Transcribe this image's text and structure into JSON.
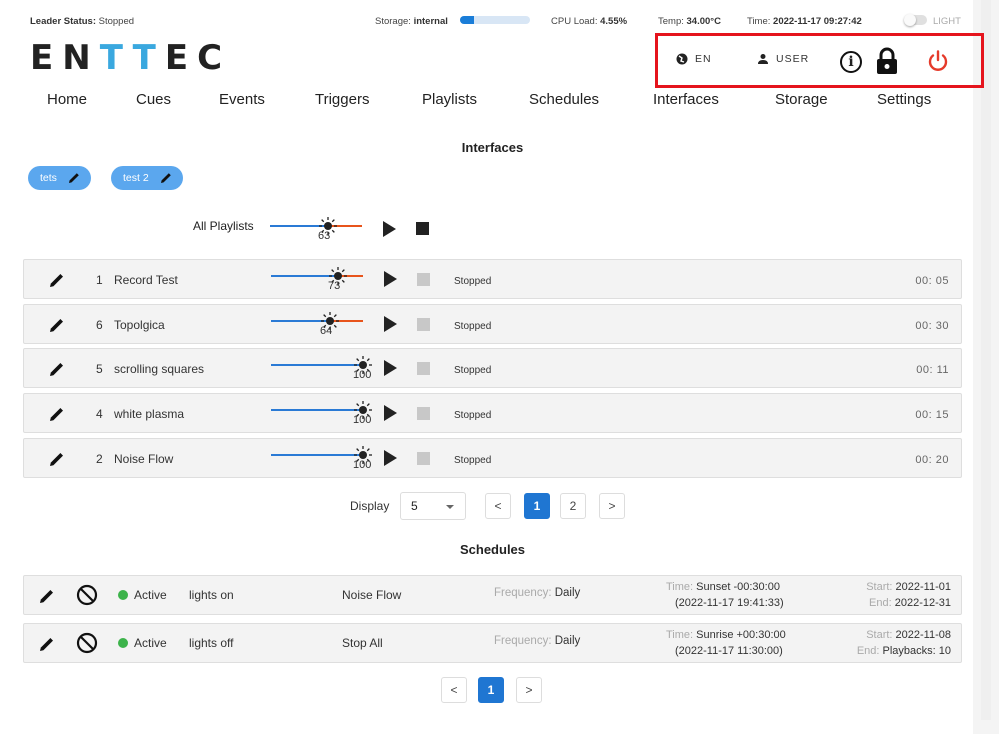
{
  "status": {
    "leader_label": "Leader Status:",
    "leader_value": "Stopped",
    "storage_label": "Storage:",
    "storage_value": "internal",
    "storage_fill": 0.2,
    "cpu_label": "CPU Load:",
    "cpu_value": "4.55%",
    "temp_label": "Temp:",
    "temp_value": "34.00°C",
    "time_label": "Time:",
    "time_value": "2022-11-17 09:27:42",
    "theme_label": "LIGHT"
  },
  "logo": {
    "part1": "EN",
    "part2": "TT",
    "part3": "EC"
  },
  "header": {
    "language": "EN",
    "user": "USER"
  },
  "nav": [
    "Home",
    "Cues",
    "Events",
    "Triggers",
    "Playlists",
    "Schedules",
    "Interfaces",
    "Storage",
    "Settings"
  ],
  "interfaces": {
    "title": "Interfaces",
    "chips": [
      "tets",
      "test 2"
    ],
    "all_label": "All Playlists",
    "all_value": 63
  },
  "playlists": [
    {
      "num": "1",
      "name": "Record Test",
      "level": 73,
      "status": "Stopped",
      "time": "00: 05"
    },
    {
      "num": "6",
      "name": "Topolgica",
      "level": 64,
      "status": "Stopped",
      "time": "00: 30"
    },
    {
      "num": "5",
      "name": "scrolling squares",
      "level": 100,
      "status": "Stopped",
      "time": "00: 11"
    },
    {
      "num": "4",
      "name": "white plasma",
      "level": 100,
      "status": "Stopped",
      "time": "00: 15"
    },
    {
      "num": "2",
      "name": "Noise Flow",
      "level": 100,
      "status": "Stopped",
      "time": "00: 20"
    }
  ],
  "pagination": {
    "display_label": "Display",
    "display_value": "5",
    "pages": [
      "1",
      "2"
    ],
    "current": "1",
    "prev": "<",
    "next": ">"
  },
  "schedules": {
    "title": "Schedules",
    "rows": [
      {
        "state": "Active",
        "name": "lights on",
        "playlist": "Noise Flow",
        "freq_label": "Frequency:",
        "freq": "Daily",
        "time_label": "Time:",
        "time": "Sunset -00:30:00",
        "time_detail": "(2022-11-17 19:41:33)",
        "start_label": "Start:",
        "start": "2022-11-01",
        "end_label": "End:",
        "end": "2022-12-31"
      },
      {
        "state": "Active",
        "name": "lights off",
        "playlist": "Stop All",
        "freq_label": "Frequency:",
        "freq": "Daily",
        "time_label": "Time:",
        "time": "Sunrise +00:30:00",
        "time_detail": "(2022-11-17 11:30:00)",
        "start_label": "Start:",
        "start": "2022-11-08",
        "end_label": "End:",
        "end": "Playbacks: 10"
      }
    ],
    "pages": [
      "1"
    ],
    "prev": "<",
    "next": ">"
  },
  "colors": {
    "accent": "#1f76d2",
    "chip": "#5ba7ee",
    "highlight": "#e5141d",
    "power": "#e53a2a",
    "active": "#3cb34a",
    "slider_left": "#2a7ad5",
    "slider_right": "#e8541b"
  }
}
